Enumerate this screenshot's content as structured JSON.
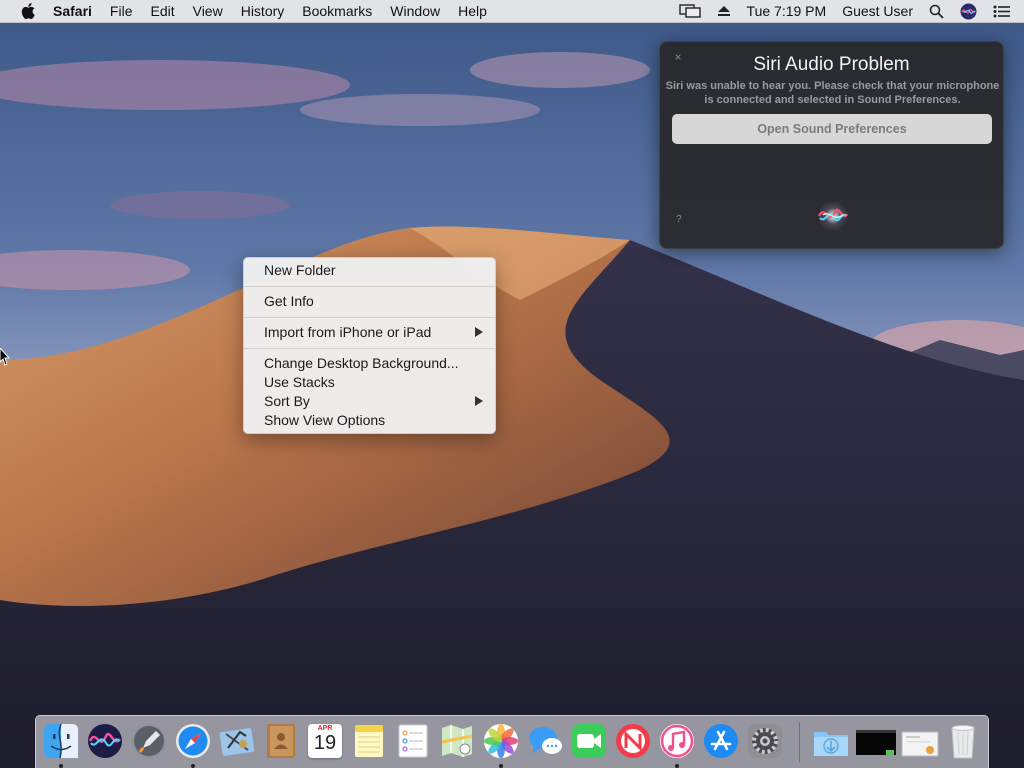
{
  "menubar": {
    "app_name": "Safari",
    "menus": [
      "File",
      "Edit",
      "View",
      "History",
      "Bookmarks",
      "Window",
      "Help"
    ],
    "clock": "Tue 7:19 PM",
    "user": "Guest User",
    "status_icons": [
      "airplay-display-icon",
      "eject-icon",
      "spotlight-search-icon",
      "siri-icon",
      "notification-center-icon"
    ]
  },
  "siri_notification": {
    "close_glyph": "×",
    "title": "Siri Audio Problem",
    "message": "Siri was unable to hear you. Please check that your microphone is connected and selected in Sound Preferences.",
    "button_label": "Open Sound Preferences",
    "help_glyph": "?"
  },
  "context_menu": {
    "items": [
      {
        "label": "New Folder"
      },
      {
        "label": "Get Info"
      },
      {
        "label": "Import from iPhone or iPad",
        "submenu": true
      },
      {
        "label": "Change Desktop Background..."
      },
      {
        "label": "Use Stacks"
      },
      {
        "label": "Sort By",
        "submenu": true
      },
      {
        "label": "Show View Options"
      }
    ]
  },
  "dock": {
    "apps": [
      {
        "name": "Finder",
        "icon": "finder-icon",
        "running": true
      },
      {
        "name": "Siri",
        "icon": "siri-icon",
        "running": false
      },
      {
        "name": "Launchpad",
        "icon": "launchpad-icon",
        "running": false
      },
      {
        "name": "Safari",
        "icon": "safari-icon",
        "running": true
      },
      {
        "name": "Mail",
        "icon": "mail-icon",
        "running": false
      },
      {
        "name": "Contacts",
        "icon": "contacts-icon",
        "running": false
      },
      {
        "name": "Calendar",
        "icon": "calendar-icon",
        "running": false,
        "month": "APR",
        "day": "19"
      },
      {
        "name": "Notes",
        "icon": "notes-icon",
        "running": false
      },
      {
        "name": "Reminders",
        "icon": "reminders-icon",
        "running": false
      },
      {
        "name": "Maps",
        "icon": "maps-icon",
        "running": false
      },
      {
        "name": "Photos",
        "icon": "photos-icon",
        "running": true
      },
      {
        "name": "Messages",
        "icon": "messages-icon",
        "running": false
      },
      {
        "name": "FaceTime",
        "icon": "facetime-icon",
        "running": false
      },
      {
        "name": "News",
        "icon": "news-icon",
        "running": false
      },
      {
        "name": "iTunes",
        "icon": "itunes-icon",
        "running": true
      },
      {
        "name": "App Store",
        "icon": "app-store-icon",
        "running": false
      },
      {
        "name": "System Preferences",
        "icon": "system-preferences-icon",
        "running": false
      },
      {
        "name": "Downloads",
        "icon": "downloads-folder-icon",
        "running": false
      },
      {
        "name": "Screen Recording",
        "icon": "screen-recording-icon",
        "running": false
      },
      {
        "name": "Documents Stack",
        "icon": "documents-stack-icon",
        "running": false
      },
      {
        "name": "Trash",
        "icon": "trash-icon",
        "running": false
      }
    ]
  },
  "colors": {
    "sky_top": "#3d5a86",
    "sky_pink": "#c58aa6",
    "dune_light": "#c98d5c",
    "dune_dark": "#2c2a3c"
  }
}
